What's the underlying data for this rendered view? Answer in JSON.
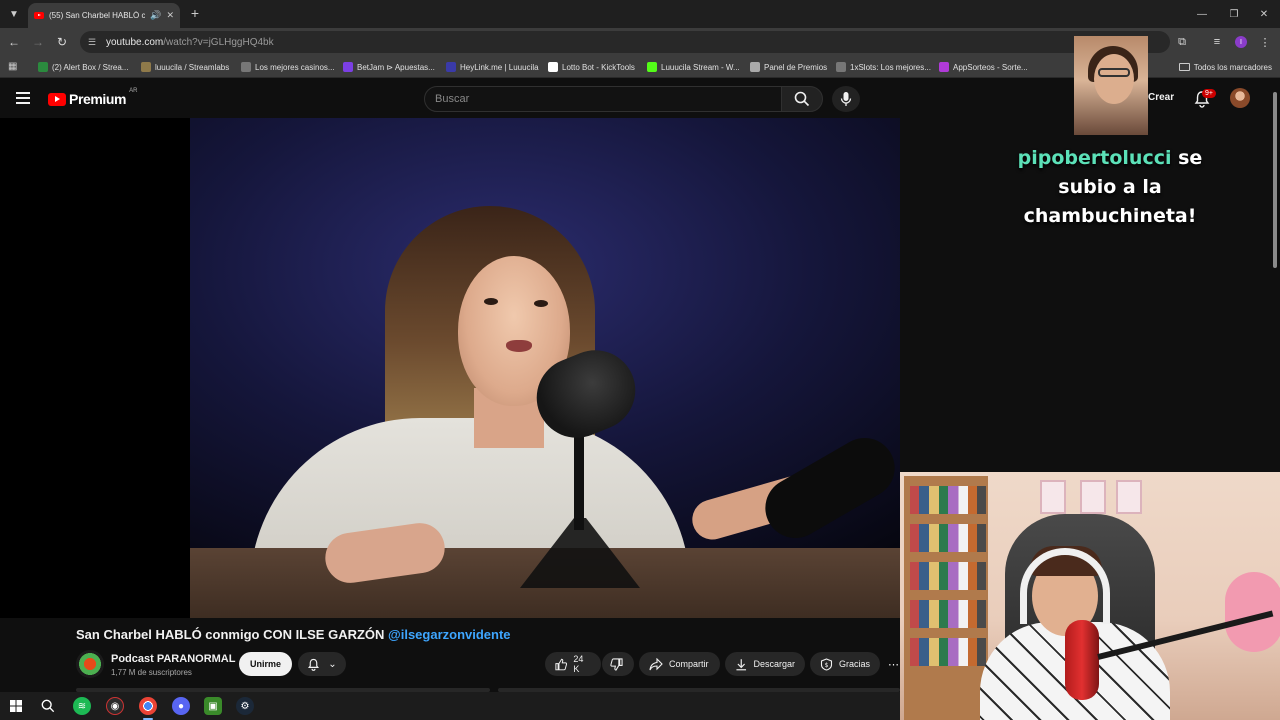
{
  "browser": {
    "tab": {
      "title": "(55) San Charbel HABLÓ co"
    },
    "address": {
      "host": "youtube.com",
      "path": "/watch?v=jGLHggHQ4bk"
    },
    "bookmarks": [
      {
        "label": "(2) Alert Box / Strea...",
        "color": "#2b8a3e"
      },
      {
        "label": "luuucila / Streamlabs",
        "color": "#8f7a4a"
      },
      {
        "label": "Los mejores casinos...",
        "color": "#777777"
      },
      {
        "label": "BetJam ⊳ Apuestas...",
        "color": "#7b3fe4"
      },
      {
        "label": "HeyLink.me | Luuucila",
        "color": "#3a3aa8"
      },
      {
        "label": "Lotto Bot - KickTools",
        "color": "#ffffff"
      },
      {
        "label": "Luuucila Stream - W...",
        "color": "#53fc18"
      },
      {
        "label": "Panel de Premios",
        "color": "#aaaaaa"
      },
      {
        "label": "1xSlots: Los mejores...",
        "color": "#777777"
      },
      {
        "label": "AppSorteos - Sorte...",
        "color": "#b03ad8"
      }
    ],
    "all_bookmarks": "Todos los marcadores"
  },
  "youtube": {
    "logo_word": "Premium",
    "country_code": "AR",
    "search_placeholder": "Buscar",
    "create_label": "Crear",
    "notifications_badge": "9+",
    "video": {
      "title": "San Charbel HABLÓ conmigo CON ILSE GARZÓN",
      "mention": "@ilsegarzonvidente"
    },
    "channel": {
      "name": "Podcast PARANORMAL",
      "subscribers": "1,77 M de suscriptores",
      "join_label": "Unirme"
    },
    "actions": {
      "likes": "24 K",
      "share": "Compartir",
      "download": "Descargar",
      "thanks": "Gracias"
    }
  },
  "overlay": {
    "donation_user": "pipobertolucci",
    "donation_text_1": "se",
    "donation_text_2": "subio a la",
    "donation_text_3": "chambuchineta!"
  },
  "colors": {
    "youtube_red": "#ff0000",
    "mention_blue": "#3ea6ff",
    "donation_user": "#5ce1b8"
  }
}
